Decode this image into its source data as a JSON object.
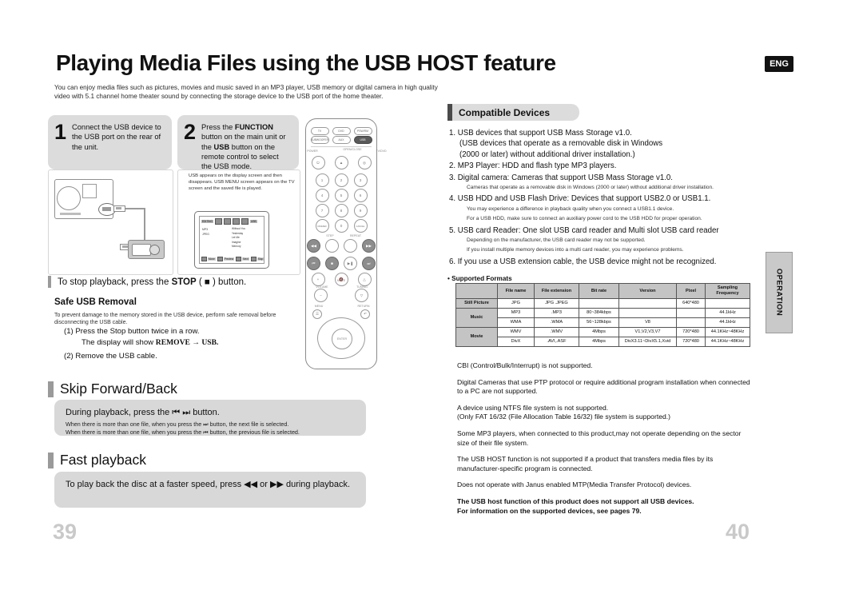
{
  "header": {
    "title": "Playing Media Files using the USB HOST feature",
    "intro": "You can enjoy media files such as pictures, movies and music saved in an MP3 player, USB memory or digital camera in high quality video with 5.1 channel home theater sound by connecting the storage device to the USB port of the home theater.",
    "language_badge": "ENG",
    "side_tab": "OPERATION"
  },
  "steps": [
    {
      "number": "1",
      "text_parts": [
        "Connect the USB device to the USB port on the rear of the unit."
      ]
    },
    {
      "number": "2",
      "text_html": "Press the <b>FUNCTION</b> button on the main unit or the <b>USB</b> button on the remote control to select the USB mode."
    }
  ],
  "step_note": "USB  appears on the display screen and then disappears.\nUSB MENU screen appears on the TV screen and the saved file is played.",
  "tv_menu": {
    "topbar_label": "EDITING",
    "topbar_right": "USB",
    "left_items": [
      "MP3",
      "JPEG"
    ],
    "right_items": [
      "Without You",
      "Yesterday",
      "Let Me",
      "Imagine",
      "Memory"
    ],
    "bottom_buttons": [
      "Move",
      "Preview",
      "Next",
      "Stop"
    ]
  },
  "stop_line": {
    "prefix": "To stop playback, press the ",
    "bold": "STOP",
    "suffix": " ( ■ ) button."
  },
  "safe_removal": {
    "heading": "Safe USB Removal",
    "note": "To prevent damage to the memory stored in the USB device, perform safe removal before disconnecting the USB cable.",
    "item1_line1": "(1)  Press the Stop button twice in a row.",
    "item1_line2_prefix": "The display will show ",
    "item1_line2_bold": "REMOVE → USB.",
    "item2": "(2) Remove the USB cable."
  },
  "sections": [
    {
      "heading": "Skip Forward/Back",
      "main": "During playback, press the ⏮ ⏭ button.",
      "sub": [
        "When there is more than one file, when you press the ⏭ button, the next file is selected.",
        "When there is more than one file, when you press the ⏮ button, the previous file is selected."
      ]
    },
    {
      "heading": "Fast playback",
      "main": "To play back the disc at a faster speed, press ◀◀ or ▶▶ during playback.",
      "sub": []
    }
  ],
  "compatible": {
    "heading": "Compatible Devices",
    "items": [
      {
        "n": "1.",
        "lines": [
          "USB devices that support USB Mass Storage v1.0.",
          "(USB devices that operate as a removable disk in Windows",
          "(2000 or later) without additional driver installation.)"
        ],
        "notes": []
      },
      {
        "n": "2.",
        "lines": [
          "MP3 Player: HDD and flash type MP3 players."
        ],
        "notes": []
      },
      {
        "n": "3.",
        "lines": [
          "Digital camera: Cameras that support USB Mass Storage v1.0."
        ],
        "notes": [
          "Cameras that operate as a removable disk in Windows (2000 or later) without additional driver installation."
        ]
      },
      {
        "n": "4.",
        "lines": [
          "USB HDD and USB Flash Drive: Devices that support USB2.0 or USB1.1."
        ],
        "notes": [
          "You may experience a difference in playback quality when you connect a USB1.1 device.",
          "For a USB HDD, make sure to connect an auxiliary power cord to the USB HDD for proper operation."
        ]
      },
      {
        "n": "5.",
        "lines": [
          "USB card Reader: One slot USB card reader and Multi slot USB card reader"
        ],
        "notes": [
          "Depending on the manufacturer, the USB card reader may not be supported.",
          "If you install multiple memory devices into a multi card reader, you may experience problems."
        ]
      },
      {
        "n": "6.",
        "lines": [
          "If you use a USB extension cable, the USB device might not be recognized."
        ],
        "notes": []
      }
    ]
  },
  "formats": {
    "title": "• Supported Formats",
    "columns": [
      "",
      "File name",
      "File extension",
      "Bit rate",
      "Version",
      "Pixel",
      "Sampling Frequency"
    ],
    "rows": [
      {
        "group": "Still Picture",
        "span": 1,
        "cells": [
          "JPG",
          "JPG  .JPEG",
          "",
          "",
          "640*480",
          ""
        ]
      },
      {
        "group": "Music",
        "span": 2,
        "cells": [
          "MP3",
          ".MP3",
          "80~384kbps",
          "",
          "",
          "44.1kHz"
        ]
      },
      {
        "group": "",
        "span": 0,
        "cells": [
          "WMA",
          ".WMA",
          "56~128kbps",
          "V8",
          "",
          "44.1kHz"
        ]
      },
      {
        "group": "Movie",
        "span": 2,
        "cells": [
          "WMV",
          ".WMV",
          "4Mbps",
          "V1,V2,V3,V7",
          "720*480",
          "44.1KHz~48KHz"
        ]
      },
      {
        "group": "",
        "span": 0,
        "cells": [
          "DivX",
          ".AVI,.ASF",
          "4Mbps",
          "DivX3.11~DivX5.1,Xvid",
          "720*480",
          "44.1KHz~48KHz"
        ]
      }
    ]
  },
  "tail_paragraphs": [
    {
      "text": "CBI (Control/Bulk/Interrupt) is not supported.",
      "bold": false
    },
    {
      "text": "Digital Cameras that use PTP protocol or require additional program installation when connected to a PC are not supported.",
      "bold": false
    },
    {
      "text": "A device using NTFS file system is not supported.\n(Only FAT 16/32 (File Allocation Table 16/32) file system is supported.)",
      "bold": false
    },
    {
      "text": "Some MP3 players, when connected to this product,may not operate depending on the sector size of their file system.",
      "bold": false
    },
    {
      "text": "The USB HOST function is not supported if a product that transfers media files by its manufacturer-specific program is connected.",
      "bold": false
    },
    {
      "text": "Does not operate with Janus enabled MTP(Media Transfer Protocol) devices.",
      "bold": false
    },
    {
      "text": "The USB host function of this product does not support all USB devices.\nFor information on the supported devices, see pages 79.",
      "bold": true
    }
  ],
  "page_numbers": {
    "left": "39",
    "right": "40"
  },
  "remote": {
    "source_buttons": [
      "TV",
      "DVD",
      "PSW/RM"
    ],
    "source_buttons2": [
      "SUBWOOFER",
      "AUX",
      "USB"
    ],
    "power_label": "POWER",
    "open_close": "OPEN/CLOSE",
    "tv_dvd": "TV/DVD",
    "keys": [
      "1",
      "2",
      "3",
      "4",
      "5",
      "6",
      "7",
      "8",
      "9",
      "DIMMER",
      "0",
      "CANCEL"
    ],
    "step_label": "STEP",
    "repeat_label": "REPEAT",
    "mute_label": "MUTE",
    "volume_label": "VOLUME",
    "tuning_label": "TUNING",
    "menu_label": "MENU",
    "return_label": "RETURN",
    "enter_label": "ENTER",
    "info_label": "INFO",
    "search_label": "P/S SEARCH",
    "display_label": "SR DISPLAY"
  },
  "colors": {
    "title_bar": "#7d7d7d",
    "step_box": "#dcdcdc",
    "grey_box": "#d8d8d8",
    "table_header": "#c4c4c4",
    "page_number": "#c9c9c9",
    "badge_bg": "#111111"
  }
}
